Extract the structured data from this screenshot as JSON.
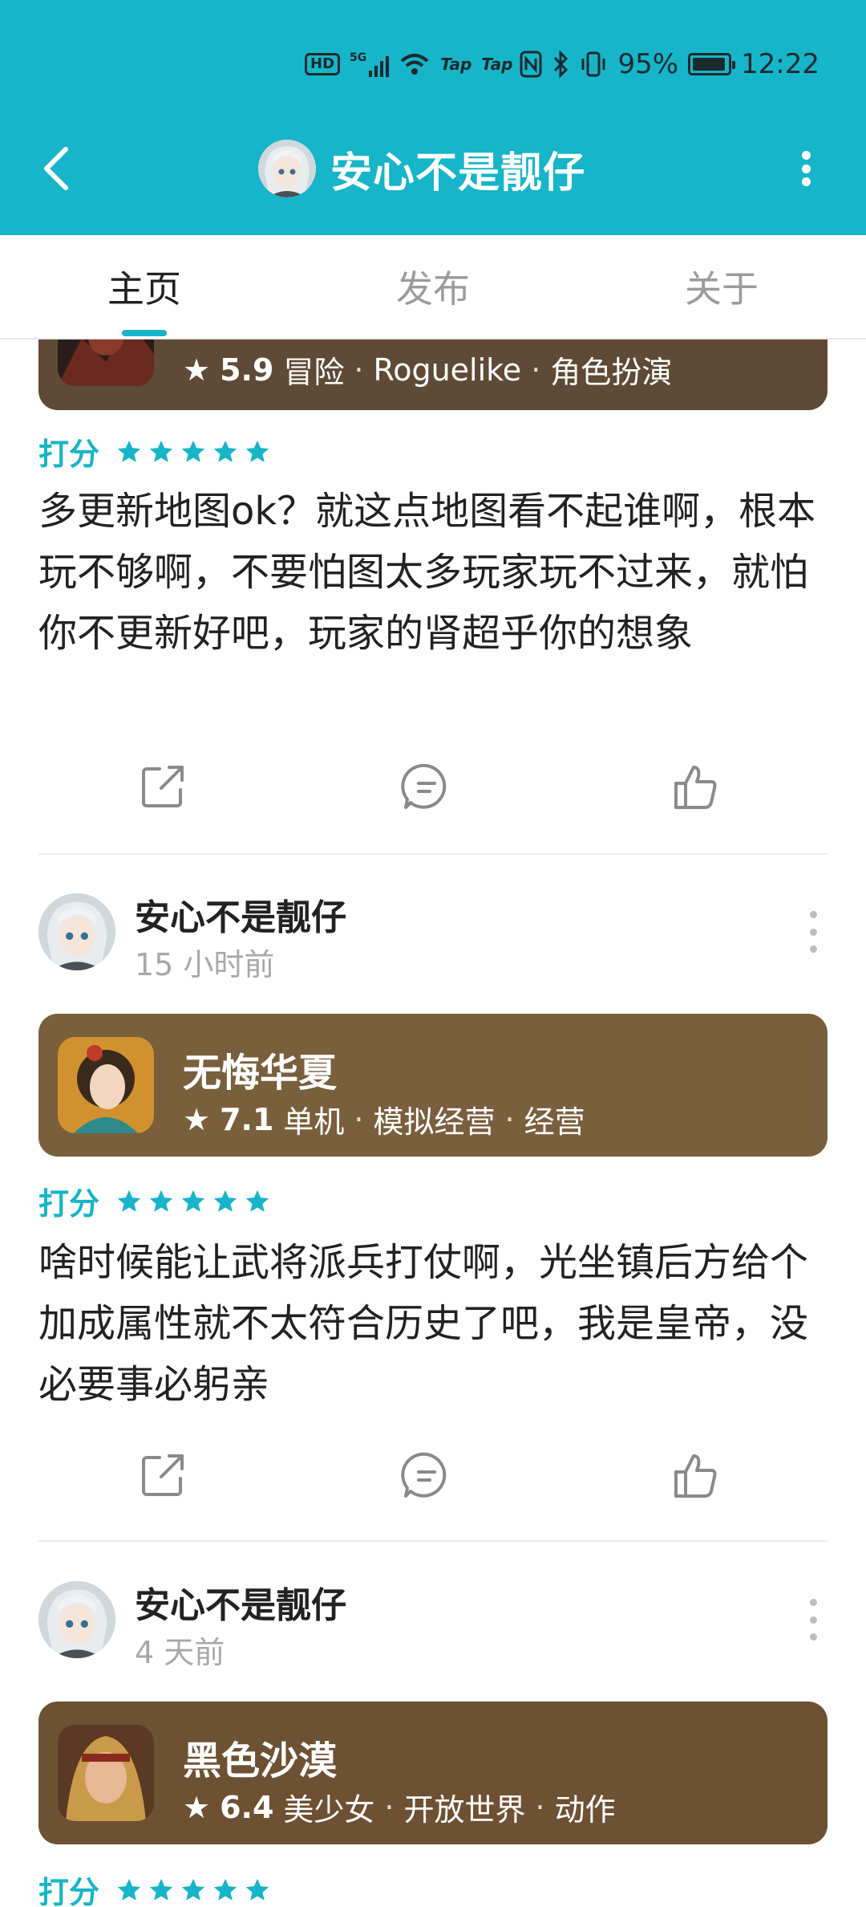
{
  "status_bar": {
    "hd": "HD",
    "network": "5G",
    "tap1": "Tap",
    "tap2": "Tap",
    "battery_pct": "95%",
    "battery_level": 0.95,
    "time": "12:22"
  },
  "header": {
    "title": "安心不是靓仔"
  },
  "tabs": [
    {
      "label": "主页",
      "active": true
    },
    {
      "label": "发布",
      "active": false
    },
    {
      "label": "关于",
      "active": false
    }
  ],
  "colors": {
    "accent": "#17b5c9",
    "card1": "#5e4a36",
    "card2": "#7a5f3d",
    "card3": "#6e5132"
  },
  "posts": [
    {
      "game": {
        "name": "",
        "rating": "5.9",
        "tags": [
          "冒险",
          "Roguelike",
          "角色扮演"
        ]
      },
      "score_label": "打分",
      "stars": 5,
      "text": "多更新地图ok？就这点地图看不起谁啊，根本玩不够啊，不要怕图太多玩家玩不过来，就怕你不更新好吧，玩家的肾超乎你的想象"
    },
    {
      "author": "安心不是靓仔",
      "time": "15 小时前",
      "game": {
        "name": "无悔华夏",
        "rating": "7.1",
        "tags": [
          "单机",
          "模拟经营",
          "经营"
        ]
      },
      "score_label": "打分",
      "stars": 5,
      "text": "啥时候能让武将派兵打仗啊，光坐镇后方给个加成属性就不太符合历史了吧，我是皇帝，没必要事必躬亲"
    },
    {
      "author": "安心不是靓仔",
      "time": "4 天前",
      "game": {
        "name": "黑色沙漠",
        "rating": "6.4",
        "tags": [
          "美少女",
          "开放世界",
          "动作"
        ]
      },
      "score_label": "打分",
      "stars": 5
    }
  ],
  "icons": {
    "back": "back-arrow-icon",
    "menu": "more-vertical-icon",
    "share": "share-icon",
    "comment": "comment-icon",
    "like": "thumbs-up-icon",
    "star": "star-icon"
  }
}
